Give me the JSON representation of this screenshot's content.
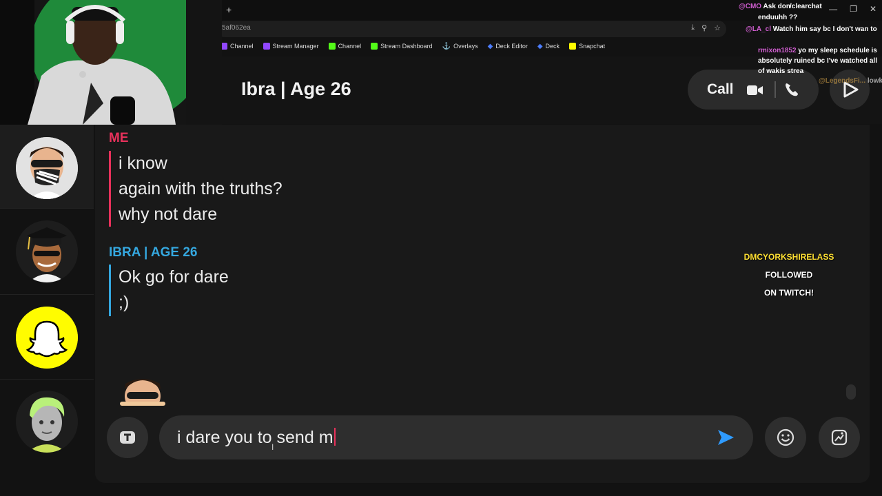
{
  "browser": {
    "new_tab": "+",
    "url": "5af062ea",
    "window_controls": [
      "—",
      "❐",
      "✕"
    ],
    "bookmarks": [
      {
        "label": "Channel",
        "color": "#9147ff"
      },
      {
        "label": "Stream Manager",
        "color": "#9147ff"
      },
      {
        "label": "Channel",
        "color": "#53fc18"
      },
      {
        "label": "Stream Dashboard",
        "color": "#53fc18"
      },
      {
        "label": "Overlays",
        "color": "#cccccc"
      },
      {
        "label": "Deck Editor",
        "color": "#4c7dff"
      },
      {
        "label": "Deck",
        "color": "#4c7dff"
      },
      {
        "label": "Snapchat",
        "color": "#fffc00"
      }
    ]
  },
  "chat": {
    "title": "Ibra | Age 26",
    "call_label": "Call",
    "me_label": "ME",
    "me_messages": [
      "i know",
      "again with the truths?",
      "why not dare"
    ],
    "ibra_label": "IBRA | AGE 26",
    "ibra_messages": [
      "Ok go for dare",
      ";)"
    ],
    "input_value": "i dare you to send m"
  },
  "stream_chat": [
    {
      "user": "@CMO",
      "text": "Ask don"
    },
    {
      "user": "",
      "text": "/clearchat"
    },
    {
      "user": "",
      "text": "enduuhh  ??"
    },
    {
      "user": "@LA_cl",
      "text": "Watch him say bc I don't wan to"
    },
    {
      "user": "rmixon1852",
      "text": "yo my sleep schedule is absolutely ruined bc I've watched all of wakis strea"
    },
    {
      "user": "@LegendsFi...",
      "text": "lowk it's f"
    }
  ],
  "follow_alert": {
    "name": "DMCYORKSHIRELASS",
    "line1_suffix": " FOLLOWED",
    "line2": "ON TWITCH!"
  },
  "colors": {
    "me": "#e8315b",
    "ibra": "#35a8e0",
    "snap_yellow": "#fffc00",
    "send": "#2f9bff"
  }
}
